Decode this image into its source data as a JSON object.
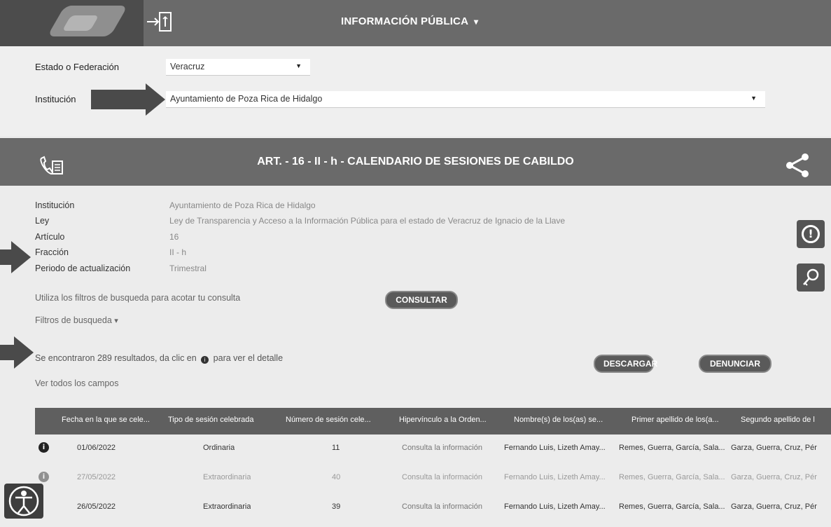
{
  "header": {
    "title": "INFORMACIÓN PÚBLICA",
    "title_caret": "⌄"
  },
  "filters": {
    "estado_label": "Estado o Federación",
    "estado_value": "Veracruz",
    "institucion_label": "Institución",
    "institucion_value": "Ayuntamiento de Poza Rica de Hidalgo"
  },
  "section": {
    "title": "ART. - 16 - II - h - CALENDARIO DE SESIONES DE CABILDO"
  },
  "meta": {
    "institucion_key": "Institución",
    "institucion_val": "Ayuntamiento de Poza Rica de Hidalgo",
    "ley_key": "Ley",
    "ley_val": "Ley de Transparencia y Acceso a la Información Pública para el estado de Veracruz de Ignacio de la Llave",
    "articulo_key": "Artículo",
    "articulo_val": "16",
    "fraccion_key": "Fracción",
    "fraccion_val": "II - h",
    "periodo_key": "Periodo de actualización",
    "periodo_val": "Trimestral"
  },
  "search": {
    "hint": "Utiliza los filtros de busqueda para acotar tu consulta",
    "consultar": "CONSULTAR",
    "filters_toggle": "Filtros de busqueda",
    "results_prefix": "Se encontraron 289 resultados, da clic en",
    "results_suffix": "para ver el detalle",
    "view_all": "Ver todos los campos",
    "descargar": "DESCARGAR",
    "denunciar": "DENUNCIAR"
  },
  "table": {
    "headers": [
      "Fecha en la que se cele...",
      "Tipo de sesión celebrada",
      "Número de sesión cele...",
      "Hipervínculo a la Orden...",
      "Nombre(s) de los(as) se...",
      "Primer apellido de los(a...",
      "Segundo apellido de l"
    ],
    "rows": [
      [
        "01/06/2022",
        "Ordinaria",
        "11",
        "Consulta la información",
        "Fernando Luis, Lizeth Amay...",
        "Remes, Guerra, García, Sala...",
        "Garza, Guerra, Cruz, Pér"
      ],
      [
        "27/05/2022",
        "Extraordinaria",
        "40",
        "Consulta la información",
        "Fernando Luis, Lizeth Amay...",
        "Remes, Guerra, García, Sala...",
        "Garza, Guerra, Cruz, Pér"
      ],
      [
        "26/05/2022",
        "Extraordinaria",
        "39",
        "Consulta la información",
        "Fernando Luis, Lizeth Amay...",
        "Remes, Guerra, García, Sala...",
        "Garza, Guerra, Cruz, Pér"
      ]
    ]
  },
  "icons": {
    "info": "i"
  }
}
